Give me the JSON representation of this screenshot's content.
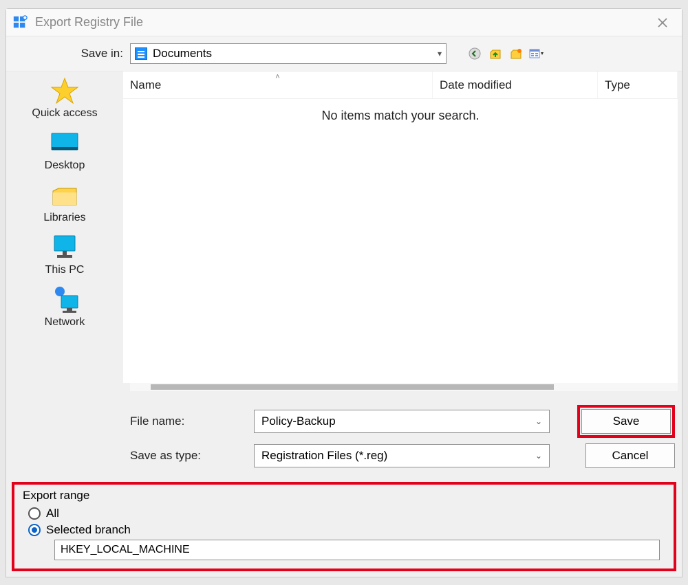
{
  "title": "Export Registry File",
  "save_in": {
    "label": "Save in:",
    "value": "Documents"
  },
  "toolbar_icons": {
    "back": "back-icon",
    "up": "go-up-icon",
    "newfolder": "new-folder-icon",
    "views": "views-icon"
  },
  "places": [
    {
      "label": "Quick access"
    },
    {
      "label": "Desktop"
    },
    {
      "label": "Libraries"
    },
    {
      "label": "This PC"
    },
    {
      "label": "Network"
    }
  ],
  "columns": {
    "name": "Name",
    "date": "Date modified",
    "type": "Type"
  },
  "empty_message": "No items match your search.",
  "file_name_label": "File name:",
  "file_name_value": "Policy-Backup",
  "save_as_type_label": "Save as type:",
  "save_as_type_value": "Registration Files (*.reg)",
  "buttons": {
    "save": "Save",
    "cancel": "Cancel"
  },
  "export_range": {
    "legend": "Export range",
    "all": "All",
    "selected": "Selected branch",
    "selected_checked": true,
    "branch_value": "HKEY_LOCAL_MACHINE"
  }
}
